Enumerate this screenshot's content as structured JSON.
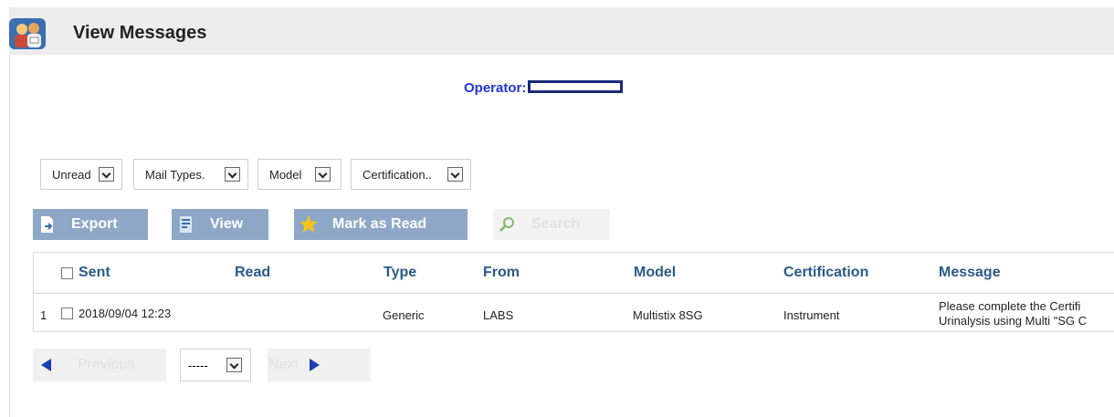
{
  "header": {
    "title": "View Messages"
  },
  "operator": {
    "label": "Operator:"
  },
  "filters": [
    {
      "value": "Unread"
    },
    {
      "value": "Mail Types."
    },
    {
      "value": "Model"
    },
    {
      "value": "Certification.."
    }
  ],
  "toolbar": {
    "export_label": "Export",
    "view_label": "View",
    "mark_read_label": "Mark as Read",
    "search_label": "Search"
  },
  "table": {
    "columns": [
      "Sent",
      "Read",
      "Type",
      "From",
      "Model",
      "Certification",
      "Message"
    ],
    "rows": [
      {
        "num": "1",
        "sent": "2018/09/04 12:23",
        "read": "",
        "type": "Generic",
        "from": "LABS",
        "model": "Multistix 8SG",
        "certification": "Instrument",
        "message_line1": "Please complete the Certifi",
        "message_line2": "Urinalysis using Multi \"SG C"
      }
    ]
  },
  "pagination": {
    "previous_label": "Previous",
    "page_select_value": "-----",
    "next_label": "Next"
  },
  "colors": {
    "button_bg": "#8ea7c7",
    "header_text": "#2a5a8a",
    "operator_text": "#2233dd",
    "nav_arrow": "#1a3fb0"
  }
}
